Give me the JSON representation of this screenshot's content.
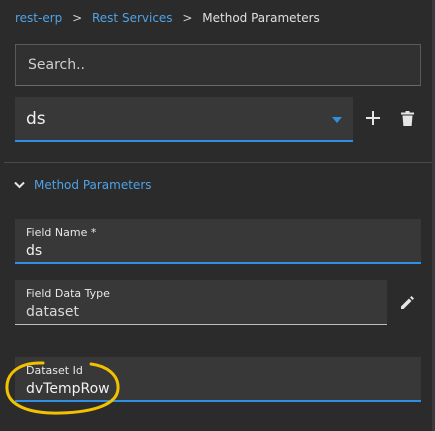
{
  "breadcrumb": {
    "items": [
      "rest-erp",
      "Rest Services"
    ],
    "separator": ">",
    "current": "Method Parameters"
  },
  "search": {
    "placeholder": "Search.."
  },
  "method_select": {
    "value": "ds"
  },
  "section": {
    "title": "Method Parameters"
  },
  "fields": {
    "field_name": {
      "label": "Field Name *",
      "value": "ds"
    },
    "field_data_type": {
      "label": "Field Data Type",
      "value": "dataset"
    },
    "dataset_id": {
      "label": "Dataset Id",
      "value": "dvTempRow"
    }
  },
  "colors": {
    "accent": "#2f8fe0",
    "link": "#4fa3e6",
    "highlight_annotation": "#f2c200"
  }
}
